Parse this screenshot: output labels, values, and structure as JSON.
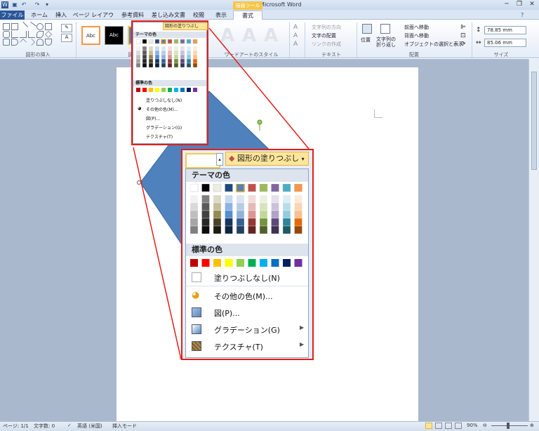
{
  "window": {
    "title": "文書 1 - Microsoft Word",
    "context_header": "描画ツール"
  },
  "tabs": [
    "ファイル",
    "ホーム",
    "挿入",
    "ページ レイアウト",
    "参考資料",
    "差し込み文書",
    "校閲",
    "表示",
    "書式"
  ],
  "ribbon": {
    "groups": {
      "insert_shapes": "図形の挿入",
      "shape_styles": "図形のスタイル",
      "wordart_styles": "ワードアートのスタイル",
      "text": "テキスト",
      "arrange": "配置",
      "size": "サイズ"
    },
    "style_samples": [
      "Abc",
      "Abc",
      "Abc"
    ],
    "wordart_samples": [
      "A",
      "A",
      "A"
    ],
    "text_cmds": [
      "文字列の方向",
      "文字の配置",
      "リンクの作成"
    ],
    "arrange": {
      "position": "位置",
      "wrap": "文字列の折り返し",
      "bring_forward": "前面へ移動",
      "send_backward": "背面へ移動",
      "selection_pane": "オブジェクトの選択と表示"
    },
    "size": {
      "height": "78.85 mm",
      "width": "85.06 mm"
    }
  },
  "fill_menu": {
    "button": "図形の塗りつぶし",
    "theme_header": "テーマの色",
    "standard_header": "標準の色",
    "no_fill": "塗りつぶしなし(N)",
    "more_colors": "その他の色(M)...",
    "picture": "図(P)...",
    "gradient": "グラデーション(G)",
    "texture": "テクスチャ(T)",
    "theme_top": [
      "#ffffff",
      "#000000",
      "#eeece1",
      "#1f497d",
      "#4f81bd",
      "#c0504d",
      "#9bbb59",
      "#8064a2",
      "#4bacc6",
      "#f79646"
    ],
    "theme_shades": [
      [
        "#f2f2f2",
        "#d9d9d9",
        "#bfbfbf",
        "#a6a6a6",
        "#808080"
      ],
      [
        "#7f7f7f",
        "#595959",
        "#404040",
        "#262626",
        "#0d0d0d"
      ],
      [
        "#ddd9c3",
        "#c4bd97",
        "#938953",
        "#4a442a",
        "#1d1b10"
      ],
      [
        "#c6d9f0",
        "#8db3e2",
        "#548dd4",
        "#17365d",
        "#0f243e"
      ],
      [
        "#dbe5f1",
        "#b8cce4",
        "#95b3d7",
        "#366092",
        "#244061"
      ],
      [
        "#f2dcdb",
        "#e5b9b7",
        "#d99694",
        "#953734",
        "#632423"
      ],
      [
        "#ebf1dd",
        "#d7e3bc",
        "#c3d69b",
        "#76923c",
        "#4f6128"
      ],
      [
        "#e5e0ec",
        "#ccc1d9",
        "#b2a2c7",
        "#5f497a",
        "#3f3151"
      ],
      [
        "#dbeef3",
        "#b7dde8",
        "#92cddc",
        "#31859b",
        "#205867"
      ],
      [
        "#fdeada",
        "#fbd5b5",
        "#fac08f",
        "#e36c09",
        "#974806"
      ]
    ],
    "standard": [
      "#c00000",
      "#ff0000",
      "#ffc000",
      "#ffff00",
      "#92d050",
      "#00b050",
      "#00b0f0",
      "#0070c0",
      "#002060",
      "#7030a0"
    ]
  },
  "status": {
    "page": "ページ: 1/1",
    "words": "文字数: 0",
    "language": "英語 (米国)",
    "mode": "挿入モード",
    "zoom": "90%"
  },
  "colors": {
    "accent": "#2b579a",
    "highlight": "#e0201c",
    "shape": "#4f81bd"
  }
}
